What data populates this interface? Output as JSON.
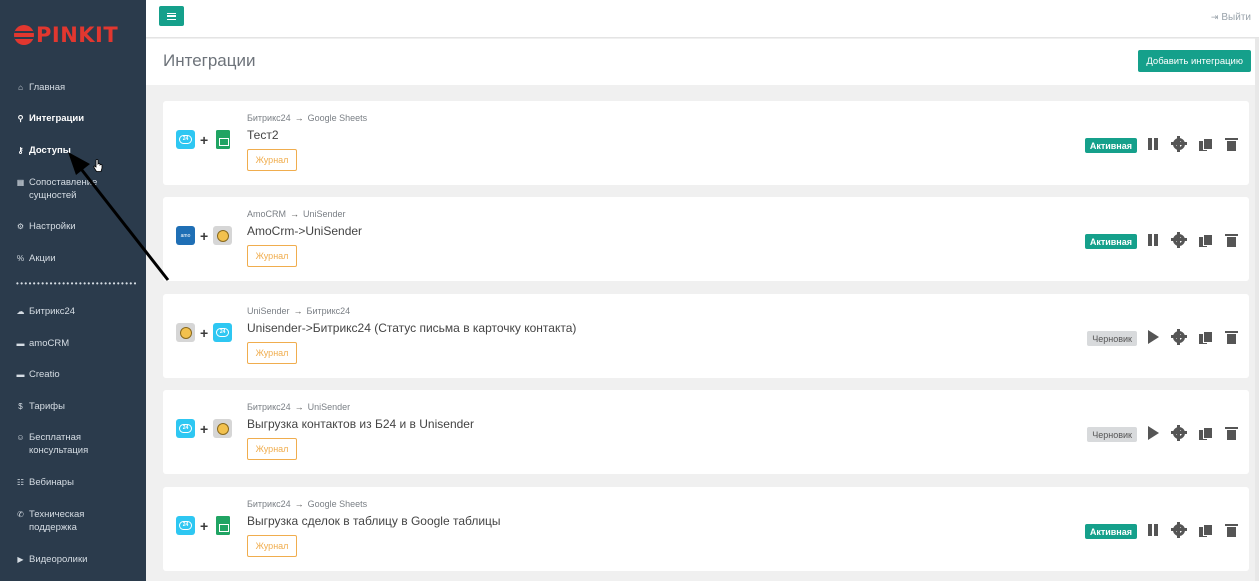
{
  "brand": {
    "logo_text": "PINKIT"
  },
  "sidebar": {
    "items": [
      {
        "label": "Главная",
        "icon": "home-icon",
        "glyph": "⌂",
        "active": false
      },
      {
        "label": "Интеграции",
        "icon": "plug-icon",
        "glyph": "⚲",
        "active": true
      },
      {
        "label": "Доступы",
        "icon": "key-icon",
        "glyph": "⚷",
        "active": true
      },
      {
        "label": "Сопоставление сущностей",
        "icon": "table-icon",
        "glyph": "▦",
        "active": false
      },
      {
        "label": "Настройки",
        "icon": "cogs-icon",
        "glyph": "⚙",
        "active": false
      },
      {
        "label": "Акции",
        "icon": "percent-icon",
        "glyph": "%",
        "active": false
      },
      {
        "label": "Битрикс24",
        "icon": "cloud-icon",
        "glyph": "☁",
        "active": false
      },
      {
        "label": "amoCRM",
        "icon": "card-icon",
        "glyph": "▬",
        "active": false
      },
      {
        "label": "Creatio",
        "icon": "card-icon",
        "glyph": "▬",
        "active": false
      },
      {
        "label": "Тарифы",
        "icon": "dollar-icon",
        "glyph": "$",
        "active": false
      },
      {
        "label": "Бесплатная консультация",
        "icon": "user-icon",
        "glyph": "☺",
        "active": false
      },
      {
        "label": "Вебинары",
        "icon": "group-icon",
        "glyph": "☷",
        "active": false
      },
      {
        "label": "Техническая поддержка",
        "icon": "support-icon",
        "glyph": "✆",
        "active": false
      },
      {
        "label": "Видеоролики",
        "icon": "video-icon",
        "glyph": "▶",
        "active": false
      }
    ],
    "divider": "••••••••••••••••••••••••••••••"
  },
  "topbar": {
    "logout_label": "Выйти",
    "logout_glyph": "⇥"
  },
  "page": {
    "title": "Интеграции",
    "add_button": "Добавить интеграцию"
  },
  "integrations": [
    {
      "from": "Битрикс24",
      "to": "Google Sheets",
      "arrow": "→",
      "name": "Тест2",
      "log": "Журнал",
      "status": "Активная",
      "state": "active",
      "plus": "+"
    },
    {
      "from": "AmoCRM",
      "to": "UniSender",
      "arrow": "→",
      "name": "AmoCrm->UniSender",
      "log": "Журнал",
      "status": "Активная",
      "state": "active",
      "plus": "+"
    },
    {
      "from": "UniSender",
      "to": "Битрикс24",
      "arrow": "→",
      "name": "Unisender->Битрикс24 (Статус письма в карточку контакта)",
      "log": "Журнал",
      "status": "Черновик",
      "state": "draft",
      "plus": "+"
    },
    {
      "from": "Битрикс24",
      "to": "UniSender",
      "arrow": "→",
      "name": "Выгрузка контактов из Б24 и в Unisender",
      "log": "Журнал",
      "status": "Черновик",
      "state": "draft",
      "plus": "+"
    },
    {
      "from": "Битрикс24",
      "to": "Google Sheets",
      "arrow": "→",
      "name": "Выгрузка сделок в таблицу в Google таблицы",
      "log": "Журнал",
      "status": "Активная",
      "state": "active",
      "plus": "+"
    }
  ],
  "colors": {
    "accent": "#15a08b",
    "sidebar_bg": "#2b3b4c",
    "log_border": "#f0ad4e"
  }
}
